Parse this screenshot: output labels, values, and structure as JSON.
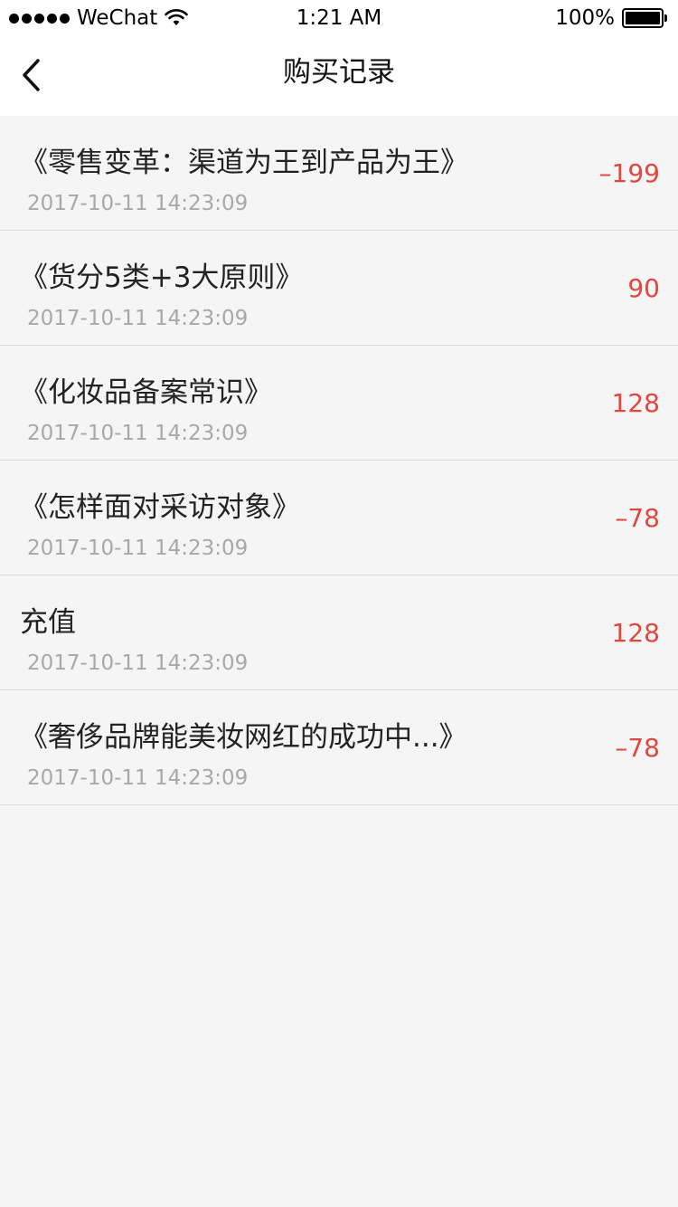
{
  "status_bar": {
    "carrier": "WeChat",
    "time": "1:21 AM",
    "battery": "100%"
  },
  "nav": {
    "title": "购买记录"
  },
  "records": [
    {
      "title": "《零售变革：渠道为王到产品为王》",
      "time": "2017-10-11 14:23:09",
      "amount": "–199"
    },
    {
      "title": "《货分5类+3大原则》",
      "time": "2017-10-11 14:23:09",
      "amount": "90"
    },
    {
      "title": "《化妆品备案常识》",
      "time": "2017-10-11 14:23:09",
      "amount": "128"
    },
    {
      "title": "《怎样面对采访对象》",
      "time": "2017-10-11 14:23:09",
      "amount": "–78"
    },
    {
      "title": "充值",
      "time": "2017-10-11 14:23:09",
      "amount": "128"
    },
    {
      "title": "《奢侈品牌能美妆网红的成功中...》",
      "time": "2017-10-11 14:23:09",
      "amount": "–78"
    }
  ],
  "colors": {
    "amount": "#e0473e",
    "background": "#f5f5f5",
    "timestamp": "#a8a8a8"
  },
  "icons": [
    "signal-dots-icon",
    "wifi-icon",
    "battery-icon",
    "back-chevron-icon"
  ]
}
